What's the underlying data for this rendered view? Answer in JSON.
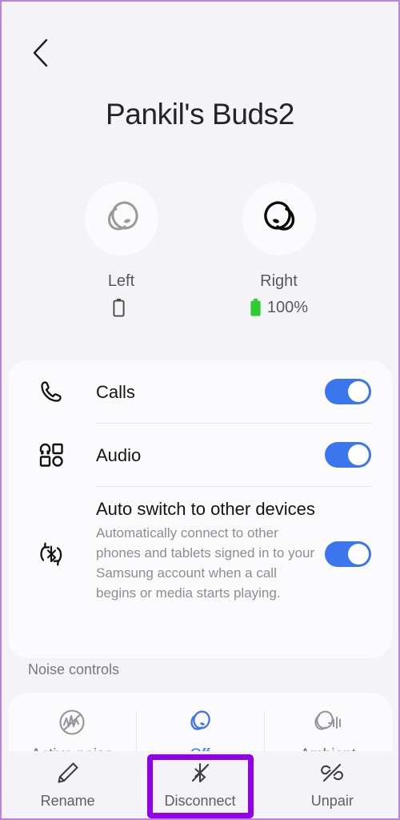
{
  "header": {
    "back_icon": "chevron-left-icon",
    "title": "Pankil's Buds2"
  },
  "buds": [
    {
      "side": "Left",
      "icon": "earbud-icon",
      "state": "disconnected",
      "battery_icon": "battery-empty-icon",
      "battery_text": "",
      "icon_color": "#9a9a9a",
      "battery_color": "#4a4a4a"
    },
    {
      "side": "Right",
      "icon": "earbud-icon",
      "state": "connected",
      "battery_icon": "battery-full-icon",
      "battery_text": "100%",
      "icon_color": "#0b0b0b",
      "battery_color": "#2ECC2E"
    }
  ],
  "settings": {
    "rows": [
      {
        "icon": "phone-icon",
        "title": "Calls",
        "desc": "",
        "toggle_on": true
      },
      {
        "icon": "media-grid-icon",
        "title": "Audio",
        "desc": "",
        "toggle_on": true
      },
      {
        "icon": "bluetooth-sync-icon",
        "title": "Auto switch to other devices",
        "desc": "Automatically connect to other phones and tablets signed in to your Samsung account when a call begins or media starts playing.",
        "toggle_on": true
      }
    ]
  },
  "noise": {
    "section_label": "Noise controls",
    "options": [
      {
        "icon": "noise-cancel-icon",
        "label": "Active noise",
        "selected": false
      },
      {
        "icon": "earbud-off-icon",
        "label": "Off",
        "selected": true
      },
      {
        "icon": "ambient-sound-icon",
        "label": "Ambient",
        "selected": false
      }
    ]
  },
  "bottom_bar": {
    "items": [
      {
        "icon": "pencil-icon",
        "label": "Rename"
      },
      {
        "icon": "bluetooth-off-icon",
        "label": "Disconnect"
      },
      {
        "icon": "unlink-icon",
        "label": "Unpair"
      }
    ]
  },
  "colors": {
    "accent_blue": "#3B76EF",
    "battery_green": "#2ECC2E",
    "highlight_purple": "#9200E8",
    "page_bg": "#F4F3F7",
    "card_bg": "#FBFAFD",
    "frame_border": "#B884DC"
  }
}
